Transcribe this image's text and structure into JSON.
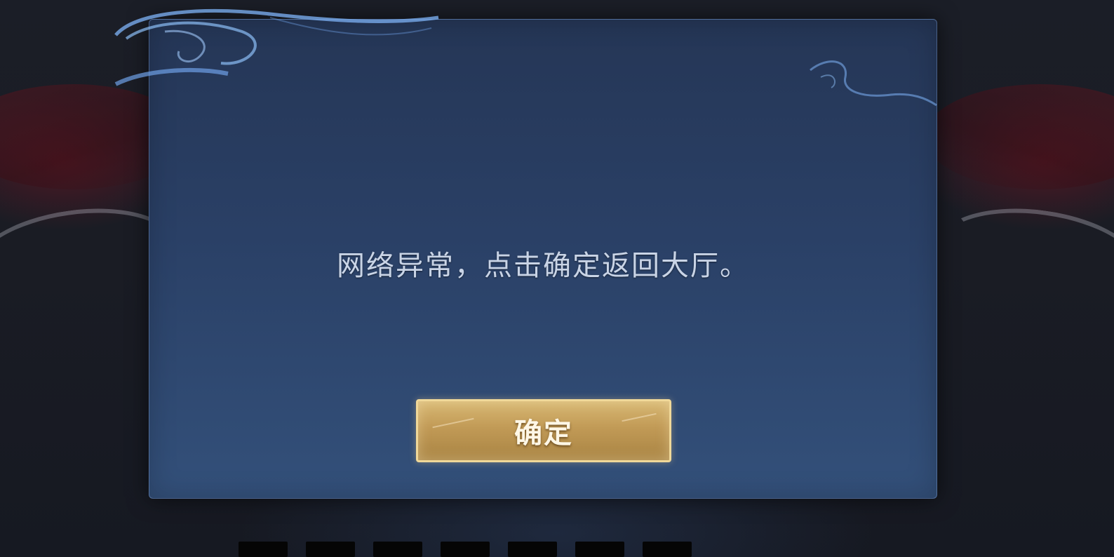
{
  "dialog": {
    "message": "网络异常，点击确定返回大厅。",
    "confirm_label": "确定"
  },
  "colors": {
    "dialog_top": "#253656",
    "dialog_bottom": "#33507a",
    "button_gold": "#c19a56",
    "button_border": "#f0d899",
    "message_text": "#c9d4e6"
  }
}
